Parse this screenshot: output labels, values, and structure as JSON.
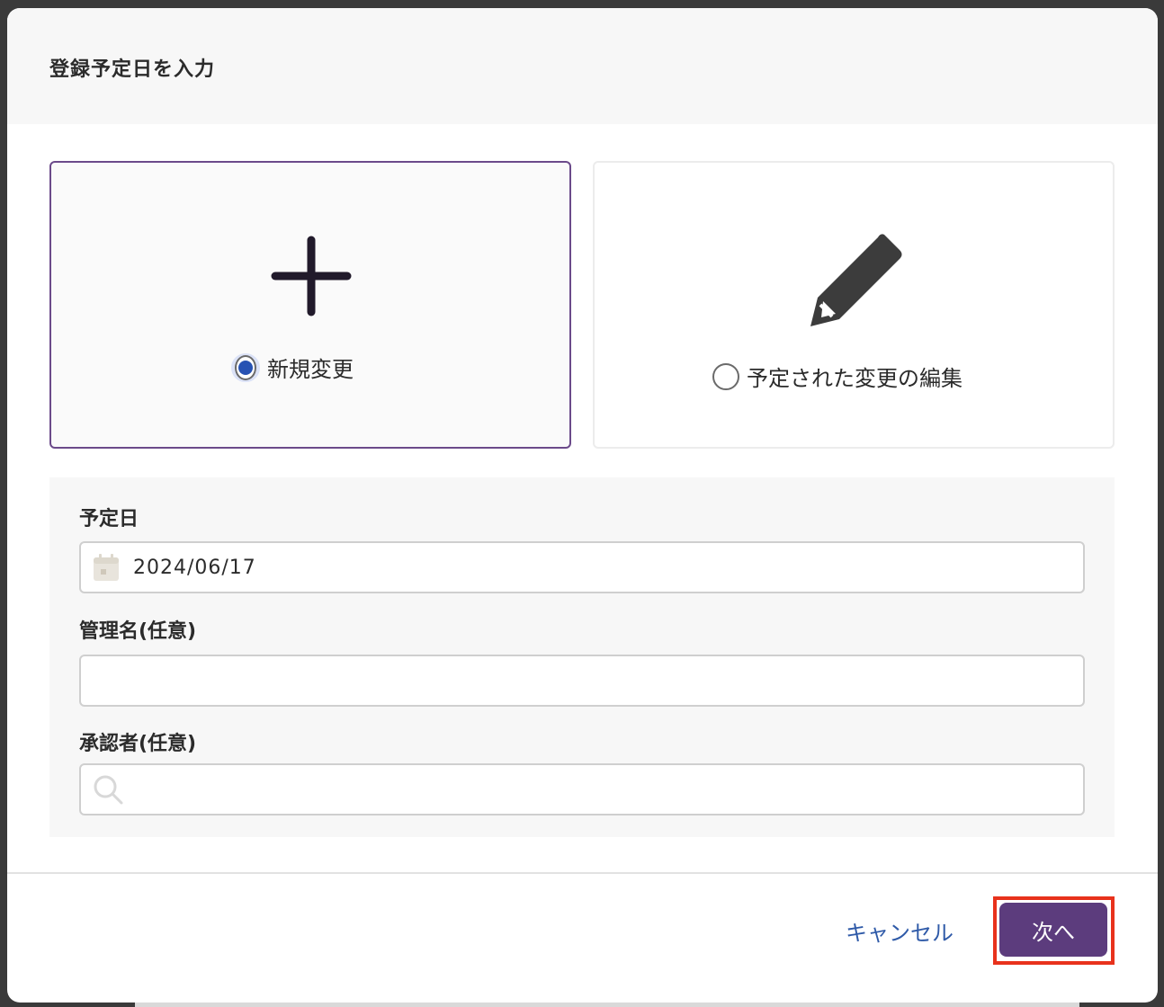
{
  "dialog": {
    "title": "登録予定日を入力"
  },
  "options": {
    "new_change": {
      "label": "新規変更",
      "selected": true,
      "icon": "plus-icon"
    },
    "edit_scheduled": {
      "label": "予定された変更の編集",
      "selected": false,
      "icon": "pencil-icon"
    }
  },
  "form": {
    "scheduled_date": {
      "label": "予定日",
      "value": "2024/06/17",
      "icon": "calendar-icon"
    },
    "management_name": {
      "label": "管理名(任意)",
      "value": "",
      "placeholder": ""
    },
    "approver": {
      "label": "承認者(任意)",
      "value": "",
      "placeholder": "",
      "icon": "search-icon"
    }
  },
  "footer": {
    "cancel_label": "キャンセル",
    "next_label": "次へ"
  },
  "colors": {
    "accent": "#5c3c7d",
    "selected_border": "#6b4a8a",
    "radio_fill": "#2752b3",
    "link": "#2f5aa8",
    "highlight": "#e8321c"
  }
}
